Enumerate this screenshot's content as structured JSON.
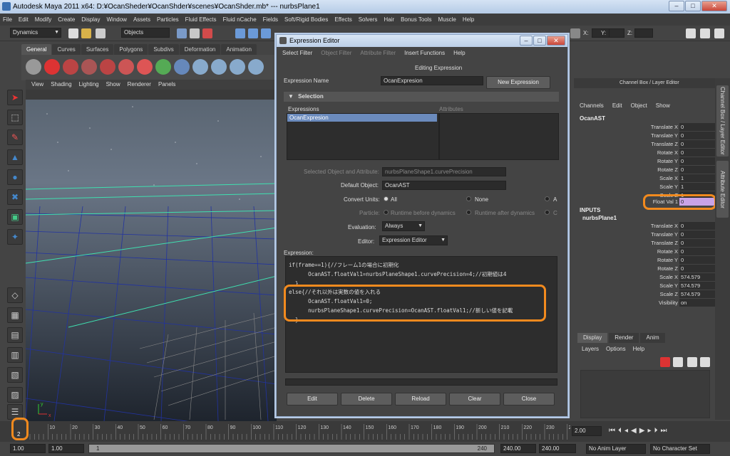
{
  "title": "Autodesk Maya 2011 x64: D:¥OcanSheder¥OcanShder¥scenes¥OcanShder.mb*   ---   nurbsPlane1",
  "menubar": [
    "File",
    "Edit",
    "Modify",
    "Create",
    "Display",
    "Window",
    "Assets",
    "Particles",
    "Fluid Effects",
    "Fluid nCache",
    "Fields",
    "Soft/Rigid Bodies",
    "Effects",
    "Solvers",
    "Hair",
    "Bonus Tools",
    "Muscle",
    "Help"
  ],
  "status": {
    "menuset": "Dynamics",
    "selection_mode": "Objects",
    "x_label": "X:",
    "y_label": "Y:",
    "z_label": "Z:"
  },
  "shelf_tabs": [
    "General",
    "Curves",
    "Surfaces",
    "Polygons",
    "Subdivs",
    "Deformation",
    "Animation"
  ],
  "viewport_menu": [
    "View",
    "Shading",
    "Lighting",
    "Show",
    "Renderer",
    "Panels"
  ],
  "axis": {
    "x": "x",
    "y": "y"
  },
  "editor": {
    "title": "Expression Editor",
    "menu": [
      "Select Filter",
      "Object Filter",
      "Attribute Filter",
      "Insert Functions",
      "Help"
    ],
    "editing_label": "Editing Expression",
    "expr_name_label": "Expression Name",
    "expr_name_value": "OcanExpresion",
    "new_expr_button": "New Expression",
    "selection_label": "Selection",
    "expressions_label": "Expressions",
    "attributes_label": "Attributes",
    "expressions_item": "OcanExpresion",
    "sel_obj_attr_label": "Selected Object and Attribute:",
    "sel_obj_attr_value": "nurbsPlaneShape1.curvePrecision",
    "default_obj_label": "Default Object:",
    "default_obj_value": "OcanAST",
    "convert_units_label": "Convert Units:",
    "cu_all": "All",
    "cu_none": "None",
    "cu_a": "A",
    "particle_label": "Particle:",
    "p_before": "Runtime before dynamics",
    "p_after": "Runtime after dynamics",
    "p_c": "C",
    "evaluation_label": "Evaluation:",
    "evaluation_value": "Always",
    "editor_label": "Editor:",
    "editor_value": "Expression Editor",
    "expression_label": "Expression:",
    "code": [
      "if(frame==1){//フレーム1の場合に初期化",
      "      OcanAST.floatVal1=nurbsPlaneShape1.curvePrecision=4;//初期値は4",
      "  }",
      "else{//それ以外は実数の値を入れる",
      "      OcanAST.floatVal1=0;",
      "      nurbsPlaneShape1.curvePrecision=OcanAST.floatVal1;//新しい値を記載",
      "  }"
    ],
    "buttons": {
      "edit": "Edit",
      "delete": "Delete",
      "reload": "Reload",
      "clear": "Clear",
      "close": "Close"
    }
  },
  "channel_box": {
    "title": "Channel Box / Layer Editor",
    "menu": [
      "Channels",
      "Edit",
      "Object",
      "Show"
    ],
    "object": "OcanAST",
    "attrs": [
      {
        "name": "Translate X",
        "value": "0"
      },
      {
        "name": "Translate Y",
        "value": "0"
      },
      {
        "name": "Translate Z",
        "value": "0"
      },
      {
        "name": "Rotate X",
        "value": "0"
      },
      {
        "name": "Rotate Y",
        "value": "0"
      },
      {
        "name": "Rotate Z",
        "value": "0"
      },
      {
        "name": "Scale X",
        "value": "1"
      },
      {
        "name": "Scale Y",
        "value": "1"
      },
      {
        "name": "Scale Z",
        "value": "1"
      }
    ],
    "float_val": {
      "name": "Float Val 1",
      "value": "0"
    },
    "inputs_label": "INPUTS",
    "input_node": "nurbsPlane1",
    "input_attrs": [
      {
        "name": "Translate X",
        "value": "0"
      },
      {
        "name": "Translate Y",
        "value": "0"
      },
      {
        "name": "Translate Z",
        "value": "0"
      },
      {
        "name": "Rotate X",
        "value": "0"
      },
      {
        "name": "Rotate Y",
        "value": "0"
      },
      {
        "name": "Rotate Z",
        "value": "0"
      },
      {
        "name": "Scale X",
        "value": "574.579"
      },
      {
        "name": "Scale Y",
        "value": "574.579"
      },
      {
        "name": "Scale Z",
        "value": "574.579"
      },
      {
        "name": "Visibility",
        "value": "on"
      }
    ]
  },
  "side_tabs": {
    "channel": "Channel Box / Layer Editor",
    "attribute": "Attribute Editor"
  },
  "layer_tabs": [
    "Display",
    "Render",
    "Anim"
  ],
  "layer_menu": [
    "Layers",
    "Options",
    "Help"
  ],
  "timeline": {
    "ticks": [
      "10",
      "20",
      "30",
      "40",
      "50",
      "60",
      "70",
      "80",
      "90",
      "100",
      "110",
      "120",
      "130",
      "140",
      "150",
      "160",
      "170",
      "180",
      "190",
      "200",
      "210",
      "220",
      "230",
      "240"
    ],
    "current_frame": "2",
    "time_field": "2.00"
  },
  "range": {
    "start": "1.00",
    "range_start": "1.00",
    "range_inner": "1",
    "range_end_inner": "240",
    "end": "240.00",
    "end2": "240.00",
    "anim_layer": "No Anim Layer",
    "char_set": "No Character Set"
  }
}
